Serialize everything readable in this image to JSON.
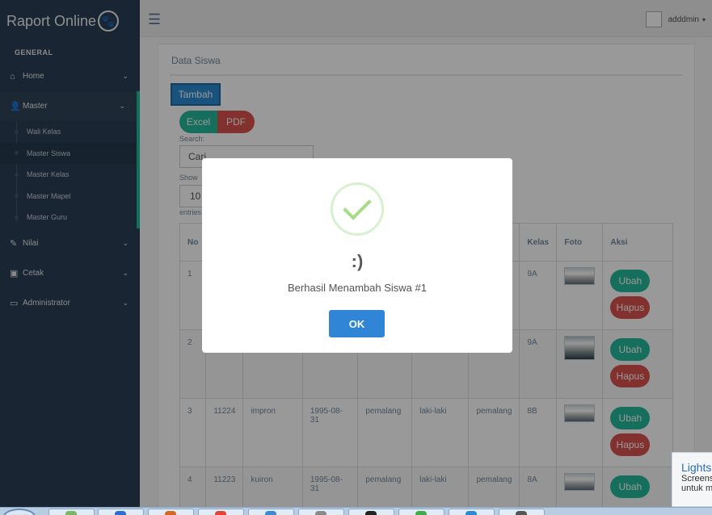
{
  "sidebar": {
    "brand": "Raport Online",
    "section": "GENERAL",
    "menu": [
      {
        "label": "Home",
        "icon": "home-icon"
      },
      {
        "label": "Master",
        "icon": "user-icon"
      },
      {
        "label": "Nilai",
        "icon": "edit-icon"
      },
      {
        "label": "Cetak",
        "icon": "print-icon"
      },
      {
        "label": "Administrator",
        "icon": "desktop-icon"
      }
    ],
    "submenu": [
      "Wali Kelas",
      "Master Siswa",
      "Master Kelas",
      "Master Mapel",
      "Master Guru"
    ]
  },
  "topnav": {
    "user": "adddmin"
  },
  "panel": {
    "title": "Data Siswa",
    "add_label": "Tambah",
    "excel_label": "Excel",
    "pdf_label": "PDF",
    "search_label": "Search:",
    "search_placeholder": "Cari",
    "show_label": "Show",
    "show_value": "10",
    "entries_label": "entries"
  },
  "table": {
    "headers": [
      "No",
      "",
      "",
      "",
      "",
      "",
      "",
      "Kelas",
      "Foto",
      "Aksi"
    ],
    "rows": [
      {
        "no": "1",
        "nis": "",
        "nama": "",
        "tgl": "",
        "tempat": "",
        "jk": "",
        "alamat": "",
        "kelas": "9A"
      },
      {
        "no": "2",
        "nis": "",
        "nama": "",
        "tgl": "",
        "tempat": "",
        "jk": "",
        "alamat": "",
        "kelas": "9A"
      },
      {
        "no": "3",
        "nis": "11224",
        "nama": "impron",
        "tgl": "1995-08-31",
        "tempat": "pemalang",
        "jk": "laki-laki",
        "alamat": "pemalang",
        "kelas": "8B"
      },
      {
        "no": "4",
        "nis": "11223",
        "nama": "kuiron",
        "tgl": "1995-08-31",
        "tempat": "pemalang",
        "jk": "laki-laki",
        "alamat": "pemalang",
        "kelas": "8A"
      }
    ],
    "edit_label": "Ubah",
    "delete_label": "Hapus"
  },
  "modal": {
    "title": ":)",
    "text": "Berhasil Menambah Siswa #1",
    "ok": "OK"
  },
  "notification": {
    "title": "Lights",
    "line1": "Screens",
    "line2": "untuk m"
  }
}
